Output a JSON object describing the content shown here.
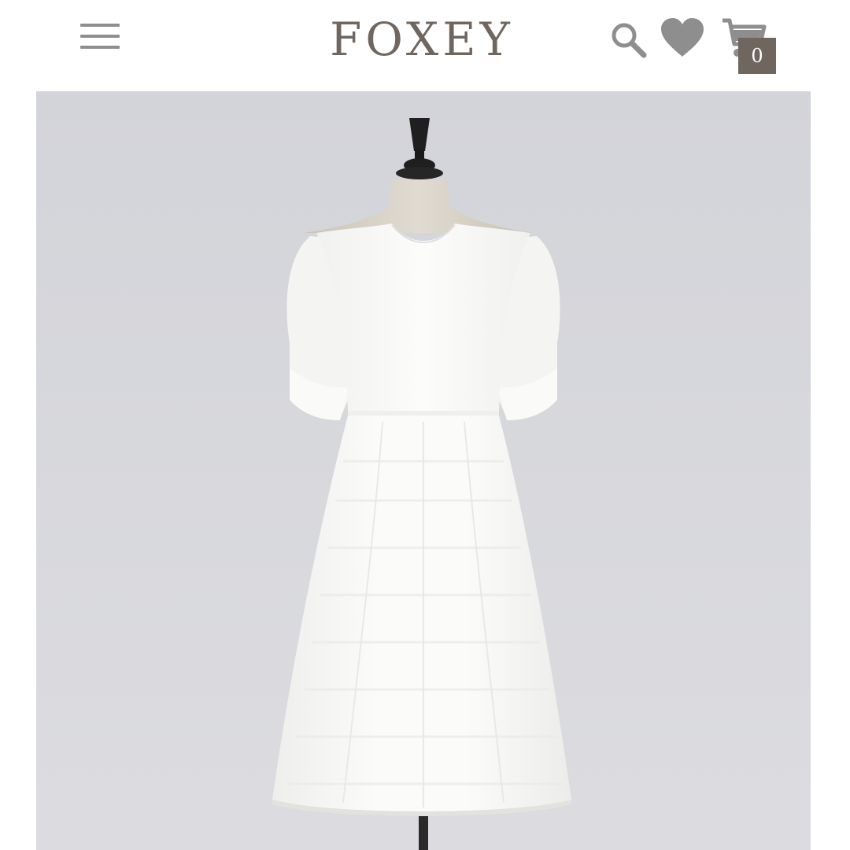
{
  "header": {
    "brand": "FOXEY",
    "menu_icon": "hamburger-menu-icon",
    "search_icon": "search-icon",
    "favorites_icon": "heart-icon",
    "cart_icon": "cart-icon",
    "cart_count": "0"
  },
  "product_image": {
    "subject": "white-dress-on-mannequin"
  },
  "colors": {
    "brand": "#6f665f",
    "icon_gray": "#8e8e8e",
    "photo_background": "#d7d7db",
    "dress": "#f8f8f6"
  }
}
